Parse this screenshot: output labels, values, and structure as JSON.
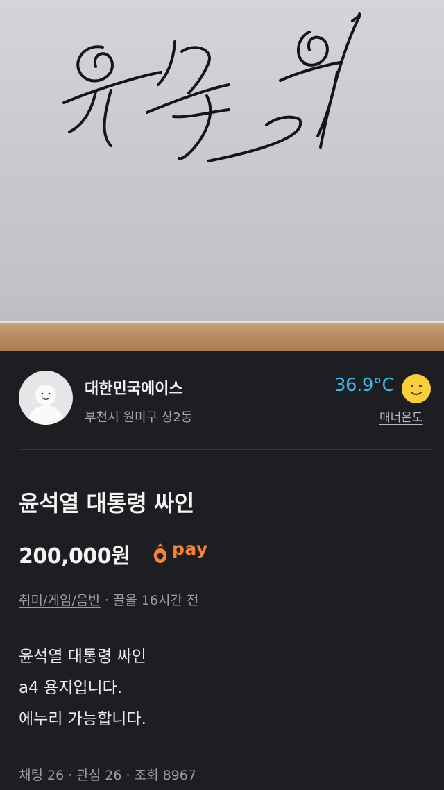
{
  "listing": {
    "image_description": "Signature handwritten on white A4 paper on a wooden table",
    "signature_text": "윤석열"
  },
  "seller": {
    "name": "대한민국에이스",
    "location": "부천시 원미구 상2동",
    "temperature": "36.9°C",
    "temperature_label": "매너온도",
    "temperature_icon": "smiley-face-icon"
  },
  "product": {
    "title": "윤석열 대통령 싸인",
    "price": "200,000원",
    "pay_label": "pay",
    "pay_icon": "carrot-pay-icon",
    "category": "취미/게임/음반",
    "separator": " · ",
    "time": "끌올 16시간 전",
    "description": [
      "윤석열 대통령 싸인",
      "a4 용지입니다.",
      "에누리 가능합니다."
    ],
    "stats": "채팅 26 · 관심 26 · 조회 8967"
  },
  "colors": {
    "background": "#1d1e22",
    "temperature": "#3fb4e8",
    "pay_accent": "#f2843a",
    "smiley": "#f6cf3a"
  }
}
